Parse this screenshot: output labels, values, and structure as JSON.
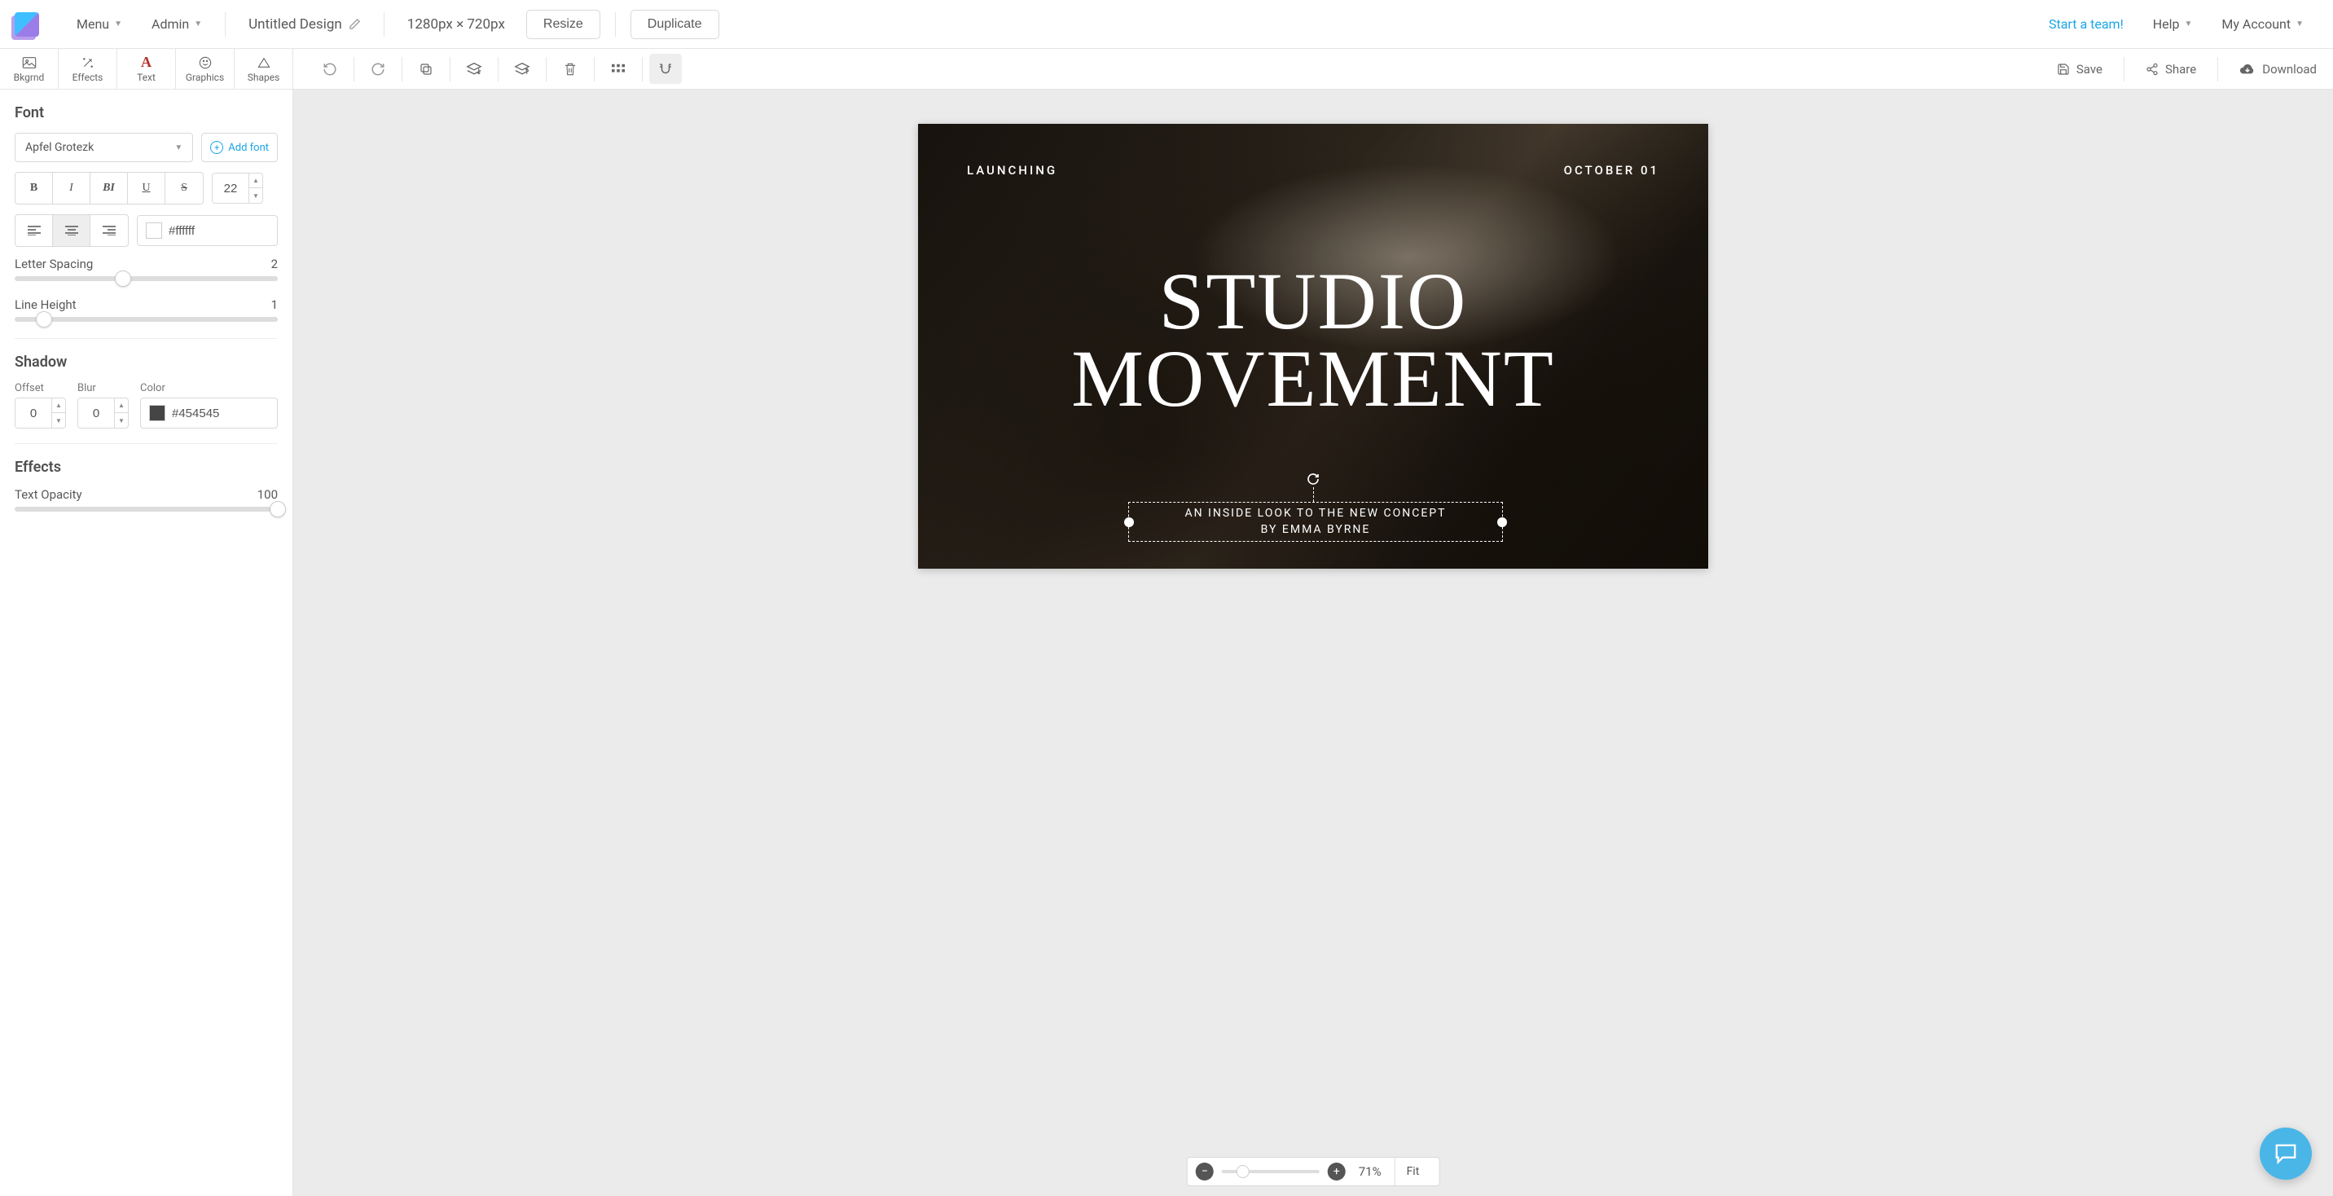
{
  "topbar": {
    "menu": "Menu",
    "admin": "Admin",
    "title": "Untitled Design",
    "dimensions": "1280px × 720px",
    "resize": "Resize",
    "duplicate": "Duplicate",
    "start_team": "Start a team!",
    "help": "Help",
    "account": "My Account"
  },
  "tools": {
    "bkgrnd": "Bkgrnd",
    "effects": "Effects",
    "text": "Text",
    "graphics": "Graphics",
    "shapes": "Shapes"
  },
  "actions": {
    "save": "Save",
    "share": "Share",
    "download": "Download"
  },
  "font_panel": {
    "heading": "Font",
    "selected_font": "Apfel Grotezk",
    "add_font": "Add font",
    "size": "22",
    "color_hex": "#ffffff",
    "letter_spacing_label": "Letter Spacing",
    "letter_spacing_value": "2",
    "line_height_label": "Line Height",
    "line_height_value": "1"
  },
  "shadow": {
    "heading": "Shadow",
    "offset_label": "Offset",
    "offset_value": "0",
    "blur_label": "Blur",
    "blur_value": "0",
    "color_label": "Color",
    "color_hex": "#454545"
  },
  "effects": {
    "heading": "Effects",
    "opacity_label": "Text Opacity",
    "opacity_value": "100"
  },
  "canvas": {
    "top_left": "LAUNCHING",
    "top_right": "OCTOBER 01",
    "title_line1": "STUDIO",
    "title_line2": "MOVEMENT",
    "sub_line1": "AN INSIDE LOOK TO THE NEW CONCEPT",
    "sub_line2": "BY EMMA BYRNE"
  },
  "zoom": {
    "value": "71%",
    "fit": "Fit"
  }
}
